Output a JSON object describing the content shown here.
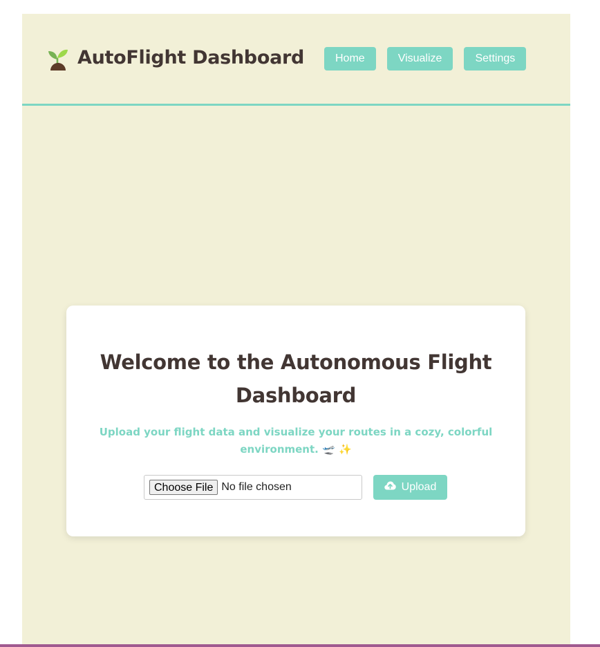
{
  "header": {
    "logo_icon": "seedling-icon",
    "title": "AutoFlight Dashboard",
    "nav": [
      {
        "label": "Home"
      },
      {
        "label": "Visualize"
      },
      {
        "label": "Settings"
      }
    ]
  },
  "card": {
    "title": "Welcome to the Autonomous Flight Dashboard",
    "subtitle": "Upload your flight data and visualize your routes in a cozy, colorful environment. 🛫 ✨",
    "file_input": {
      "button_label": "Choose File",
      "status": "No file chosen"
    },
    "upload_button": {
      "icon": "cloud-upload-icon",
      "label": "Upload"
    }
  },
  "colors": {
    "accent": "#7dd6c3",
    "background": "#f2f0d7",
    "text_dark": "#423633",
    "card": "#ffffff"
  }
}
